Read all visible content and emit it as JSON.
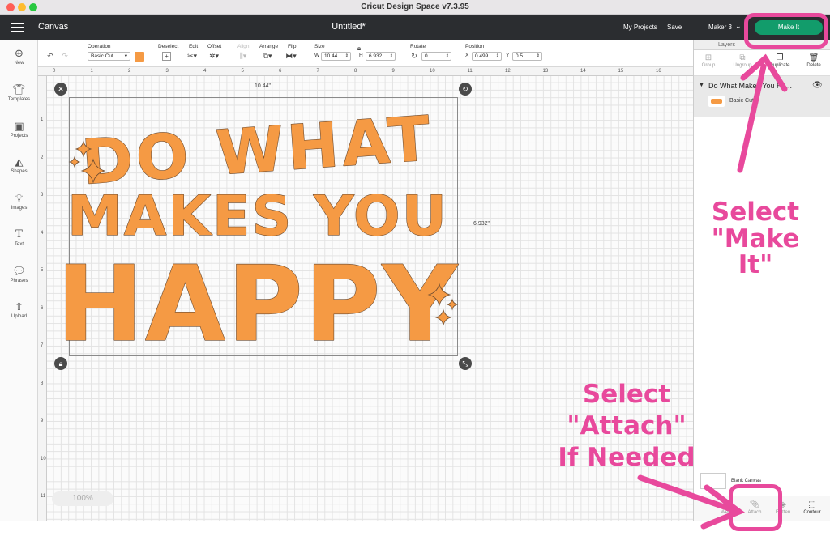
{
  "window": {
    "title": "Cricut Design Space  v7.3.95"
  },
  "header": {
    "section": "Canvas",
    "doc_title": "Untitled*",
    "my_projects": "My Projects",
    "save": "Save",
    "machine": "Maker 3",
    "make_it": "Make It"
  },
  "toolbar": {
    "operation_label": "Operation",
    "operation_value": "Basic Cut",
    "deselect_label": "Deselect",
    "edit_label": "Edit",
    "offset_label": "Offset",
    "align_label": "Align",
    "arrange_label": "Arrange",
    "flip_label": "Flip",
    "size_label": "Size",
    "w_label": "W",
    "w_value": "10.44",
    "h_label": "H",
    "h_value": "6.932",
    "rotate_label": "Rotate",
    "rotate_value": "0",
    "position_label": "Position",
    "x_label": "X",
    "x_value": "0.499",
    "y_label": "Y",
    "y_value": "0.5",
    "swatch_color": "#f59a44"
  },
  "sidebar": {
    "items": [
      {
        "label": "New",
        "icon": "plus-circle-icon"
      },
      {
        "label": "Templates",
        "icon": "shirt-icon"
      },
      {
        "label": "Projects",
        "icon": "projects-icon"
      },
      {
        "label": "Shapes",
        "icon": "shapes-icon"
      },
      {
        "label": "Images",
        "icon": "lightbulb-icon"
      },
      {
        "label": "Text",
        "icon": "text-icon"
      },
      {
        "label": "Phrases",
        "icon": "speech-bubble-icon"
      },
      {
        "label": "Upload",
        "icon": "upload-icon"
      }
    ]
  },
  "canvas": {
    "ruler_top": [
      "0",
      "1",
      "2",
      "3",
      "4",
      "5",
      "6",
      "7",
      "8",
      "9",
      "10",
      "11",
      "12",
      "13",
      "14",
      "15",
      "16"
    ],
    "ruler_left": [
      "1",
      "2",
      "3",
      "4",
      "5",
      "6",
      "7",
      "8",
      "9",
      "10",
      "11"
    ],
    "width_dim": "10.44\"",
    "height_dim": "6.932\"",
    "zoom": "100%",
    "design": {
      "line1": "DO WHAT",
      "line2": "MAKES YOU",
      "line3": "HAPPY",
      "color": "#f59a44",
      "outline": "#6b4a2f"
    }
  },
  "layers_panel": {
    "tab_layers": "Layers",
    "tools": [
      "Group",
      "Ungroup",
      "Duplicate",
      "Delete"
    ],
    "layer_name": "Do What Makes You Ha...",
    "layer_sub": "Basic Cut",
    "blank_canvas": "Blank Canvas",
    "bottom_tools": [
      "Weld",
      "Attach",
      "Flatten",
      "Contour"
    ]
  },
  "annotations": {
    "make_it": [
      "Select",
      "\"Make It\""
    ],
    "attach": [
      "Select",
      "\"Attach\"",
      "If Needed"
    ],
    "color": "#e8499c"
  }
}
